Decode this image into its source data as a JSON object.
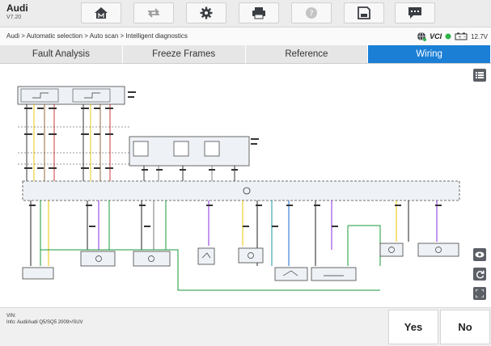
{
  "app": {
    "title": "Audi",
    "version": "V7.20"
  },
  "toolbar": {
    "icons": [
      "home-icon",
      "vehicle-swap-icon",
      "settings-icon",
      "print-icon",
      "help-icon",
      "save-icon",
      "message-icon"
    ]
  },
  "breadcrumb": "Audi > Automatic selection > Auto scan > Intelligent diagnostics",
  "status": {
    "vci_label": "VCI",
    "battery_voltage": "12.7V"
  },
  "tabs": [
    {
      "label": "Fault Analysis",
      "active": false
    },
    {
      "label": "Freeze Frames",
      "active": false
    },
    {
      "label": "Reference",
      "active": false
    },
    {
      "label": "Wiring",
      "active": true
    }
  ],
  "colors": {
    "accent": "#1b7fd6",
    "toolbar_bg": "#ececec",
    "side_button": "#5b5f66"
  },
  "footer": {
    "vin_label": "VIN:",
    "info": "Info: Audi/Audi Q5/SQ5 2009>/SUV",
    "yes_label": "Yes",
    "no_label": "No"
  }
}
